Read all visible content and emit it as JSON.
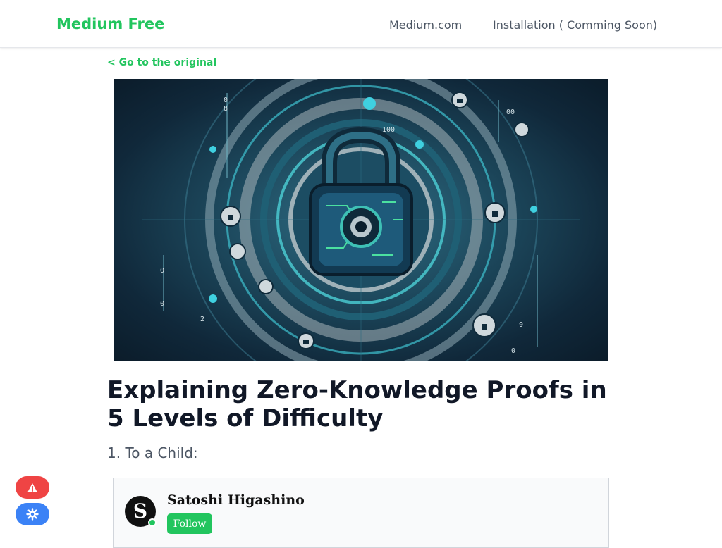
{
  "header": {
    "brand": "Medium Free",
    "nav": [
      {
        "label": "Medium.com"
      },
      {
        "label": "Installation ( Comming Soon)"
      }
    ]
  },
  "back_link": "< Go to the original",
  "article": {
    "title": "Explaining Zero-Knowledge Proofs in 5 Levels of Difficulty",
    "subtitle": "1. To a Child:"
  },
  "author": {
    "avatar_letter": "S",
    "name": "Satoshi Higashino",
    "follow_label": "Follow",
    "online_color": "#22c55e"
  },
  "floating_buttons": [
    {
      "icon": "warning-icon",
      "color": "#ef4444"
    },
    {
      "icon": "gear-icon",
      "color": "#3b82f6"
    }
  ],
  "colors": {
    "brand": "#22c55e",
    "title_text": "#111827"
  }
}
